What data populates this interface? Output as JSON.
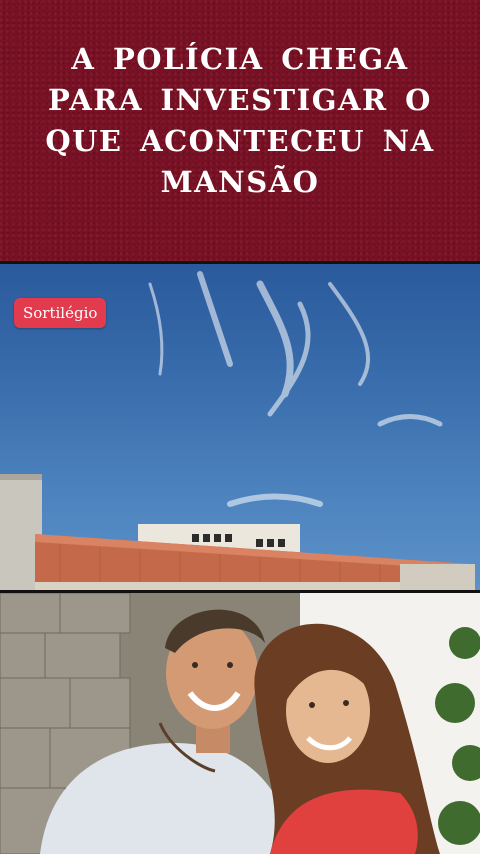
{
  "header": {
    "headline": "A POLÍCIA CHEGA PARA INVESTIGAR O QUE ACONTECEU NA MANSÃO",
    "background_color": "#7a1024"
  },
  "badge": {
    "label": "Sortilégio",
    "color": "#e23b4e"
  },
  "scene1": {
    "subject": "sky-and-mansion-roof"
  },
  "scene2": {
    "subject": "couple-promo-photo"
  }
}
